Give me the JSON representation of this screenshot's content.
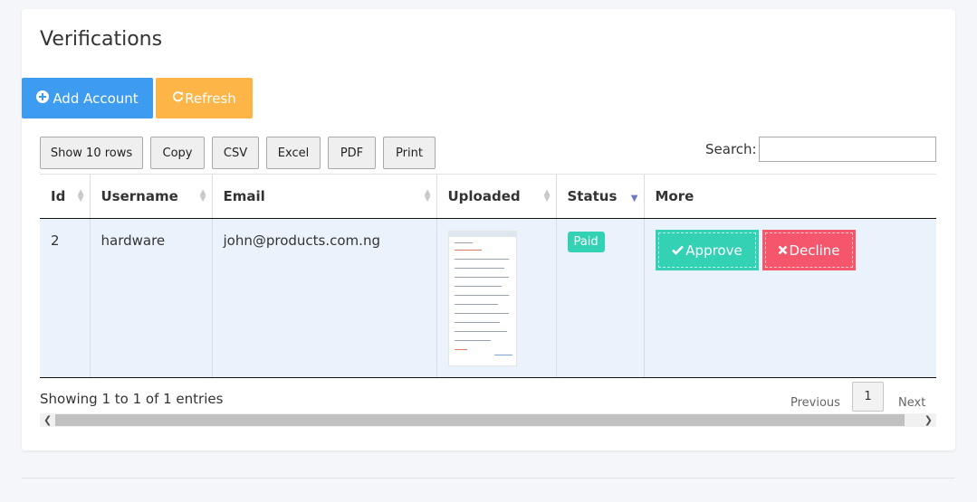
{
  "page": {
    "title": "Verifications"
  },
  "actions": {
    "add_account": "Add Account",
    "refresh": "Refresh"
  },
  "toolbar": {
    "show_rows": "Show 10 rows",
    "copy": "Copy",
    "csv": "CSV",
    "excel": "Excel",
    "pdf": "PDF",
    "print": "Print"
  },
  "search": {
    "label": "Search:",
    "value": ""
  },
  "table": {
    "columns": [
      "Id",
      "Username",
      "Email",
      "Uploaded",
      "Status",
      "More"
    ],
    "sorted_column": "Status",
    "rows": [
      {
        "id": "2",
        "username": "hardware",
        "email": "john@products.com.ng",
        "status": "Paid",
        "approve_label": "Approve",
        "decline_label": "Decline"
      }
    ]
  },
  "footer": {
    "info": "Showing 1 to 1 of 1 entries",
    "previous": "Previous",
    "page": "1",
    "next": "Next"
  },
  "icons": {
    "add_account": "plus-circle-icon",
    "refresh": "refresh-icon",
    "approve": "check-icon",
    "decline": "times-icon"
  },
  "colors": {
    "primary": "#3d9cf0",
    "warning": "#fdb548",
    "success": "#33d2b5",
    "danger": "#f5566b",
    "row_highlight": "#eaf3fc"
  }
}
